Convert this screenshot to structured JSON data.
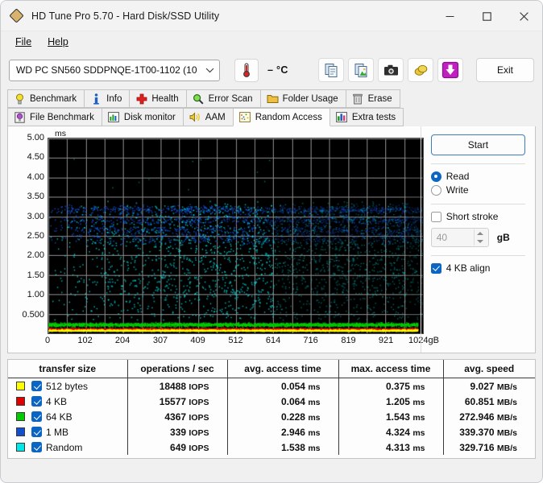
{
  "window": {
    "title": "HD Tune Pro 5.70 - Hard Disk/SSD Utility",
    "app_icon": "diamond-icon",
    "minimize": "minimize-icon",
    "maximize": "maximize-icon",
    "close": "close-icon"
  },
  "menu": {
    "items": [
      "File",
      "Help"
    ]
  },
  "toolbar": {
    "drive": "WD PC SN560 SDDPNQE-1T00-1102 (10",
    "drive_chevron": "chevron-down-icon",
    "temperature": "– °C",
    "temperature_icon": "thermometer-icon",
    "buttons": [
      {
        "name": "copy-text-icon",
        "label": ""
      },
      {
        "name": "copy-image-icon",
        "label": ""
      },
      {
        "name": "screenshot-camera-icon",
        "label": ""
      },
      {
        "name": "coins-icon",
        "label": ""
      },
      {
        "name": "download-arrow-icon",
        "label": ""
      }
    ],
    "exit_label": "Exit"
  },
  "tabs": {
    "row1": [
      {
        "label": "Benchmark",
        "icon": "lightbulb-icon",
        "active": false
      },
      {
        "label": "Info",
        "icon": "info-icon",
        "active": false
      },
      {
        "label": "Health",
        "icon": "cross-health-icon",
        "active": false
      },
      {
        "label": "Error Scan",
        "icon": "magnifier-icon",
        "active": false
      },
      {
        "label": "Folder Usage",
        "icon": "folder-icon",
        "active": false
      },
      {
        "label": "Erase",
        "icon": "trash-icon",
        "active": false
      }
    ],
    "row2": [
      {
        "label": "File Benchmark",
        "icon": "file-benchmark-icon",
        "active": false
      },
      {
        "label": "Disk monitor",
        "icon": "bar-chart-icon",
        "active": false
      },
      {
        "label": "AAM",
        "icon": "speaker-icon",
        "active": false
      },
      {
        "label": "Random Access",
        "icon": "scatter-icon",
        "active": true
      },
      {
        "label": "Extra tests",
        "icon": "extra-tests-icon",
        "active": false
      }
    ]
  },
  "controls": {
    "start_label": "Start",
    "mode": {
      "read": "Read",
      "write": "Write",
      "selected": "Read"
    },
    "short_stroke": {
      "label": "Short stroke",
      "checked": false
    },
    "short_stroke_value": "40",
    "short_stroke_unit": "gB",
    "align": {
      "label": "4 KB align",
      "checked": true
    }
  },
  "results": {
    "headers": [
      "transfer size",
      "operations / sec",
      "avg. access time",
      "max. access time",
      "avg. speed"
    ],
    "rows": [
      {
        "color": "#ffff00",
        "checked": true,
        "size": "512 bytes",
        "ops": "18488",
        "ops_unit": "IOPS",
        "avg": "0.054",
        "avg_unit": "ms",
        "max": "0.375",
        "max_unit": "ms",
        "speed": "9.027",
        "speed_unit": "MB/s"
      },
      {
        "color": "#e00000",
        "checked": true,
        "size": "4 KB",
        "ops": "15577",
        "ops_unit": "IOPS",
        "avg": "0.064",
        "avg_unit": "ms",
        "max": "1.205",
        "max_unit": "ms",
        "speed": "60.851",
        "speed_unit": "MB/s"
      },
      {
        "color": "#00cc00",
        "checked": true,
        "size": "64 KB",
        "ops": "4367",
        "ops_unit": "IOPS",
        "avg": "0.228",
        "avg_unit": "ms",
        "max": "1.543",
        "max_unit": "ms",
        "speed": "272.946",
        "speed_unit": "MB/s"
      },
      {
        "color": "#1050d0",
        "checked": true,
        "size": "1 MB",
        "ops": "339",
        "ops_unit": "IOPS",
        "avg": "2.946",
        "avg_unit": "ms",
        "max": "4.324",
        "max_unit": "ms",
        "speed": "339.370",
        "speed_unit": "MB/s"
      },
      {
        "color": "#00e8e8",
        "checked": true,
        "size": "Random",
        "ops": "649",
        "ops_unit": "IOPS",
        "avg": "1.538",
        "avg_unit": "ms",
        "max": "4.313",
        "max_unit": "ms",
        "speed": "329.716",
        "speed_unit": "MB/s"
      }
    ]
  },
  "chart_data": {
    "type": "scatter",
    "title": "",
    "xlabel": "gB",
    "ylabel": "ms",
    "xlim": [
      0,
      1024
    ],
    "ylim": [
      0,
      5.0
    ],
    "grid": true,
    "background": "#000000",
    "gridline_color": "#8a8a8a",
    "x_ticks": [
      0,
      102,
      204,
      307,
      409,
      512,
      614,
      716,
      819,
      921,
      1024
    ],
    "x_tick_labels": [
      "0",
      "102",
      "204",
      "307",
      "409",
      "512",
      "614",
      "716",
      "819",
      "921",
      "1024gB"
    ],
    "y_ticks": [
      0.5,
      1.0,
      1.5,
      2.0,
      2.5,
      3.0,
      3.5,
      4.0,
      4.5,
      5.0
    ],
    "y_tick_labels": [
      "0.500",
      "1.00",
      "1.50",
      "2.00",
      "2.50",
      "3.00",
      "3.50",
      "4.00",
      "4.50",
      "5.00"
    ],
    "legend_position": "bottom-table",
    "series": [
      {
        "name": "512 bytes",
        "color": "#ffff00",
        "avg_ms": 0.054,
        "max_ms": 0.375,
        "band_center": 0.07,
        "band_spread": 0.05,
        "n_points": 1700,
        "density": "dense-bottom"
      },
      {
        "name": "4 KB",
        "color": "#e00000",
        "avg_ms": 0.064,
        "max_ms": 1.205,
        "band_center": 0.1,
        "band_spread": 0.07,
        "n_points": 1700,
        "density": "dense-bottom"
      },
      {
        "name": "64 KB",
        "color": "#00cc00",
        "avg_ms": 0.228,
        "max_ms": 1.543,
        "band_center": 0.23,
        "band_spread": 0.09,
        "n_points": 1400,
        "density": "dense-band"
      },
      {
        "name": "1 MB",
        "color": "#1050d0",
        "avg_ms": 2.946,
        "max_ms": 4.324,
        "band_center": 3.0,
        "band_spread": 0.55,
        "n_points": 1500,
        "density": "broad-band-2.4-3.4"
      },
      {
        "name": "Random",
        "color": "#00e8e8",
        "avg_ms": 1.538,
        "max_ms": 4.313,
        "band_center": 1.55,
        "band_spread": 1.2,
        "n_points": 1500,
        "density": "scattered-0.3-3.3"
      }
    ]
  }
}
